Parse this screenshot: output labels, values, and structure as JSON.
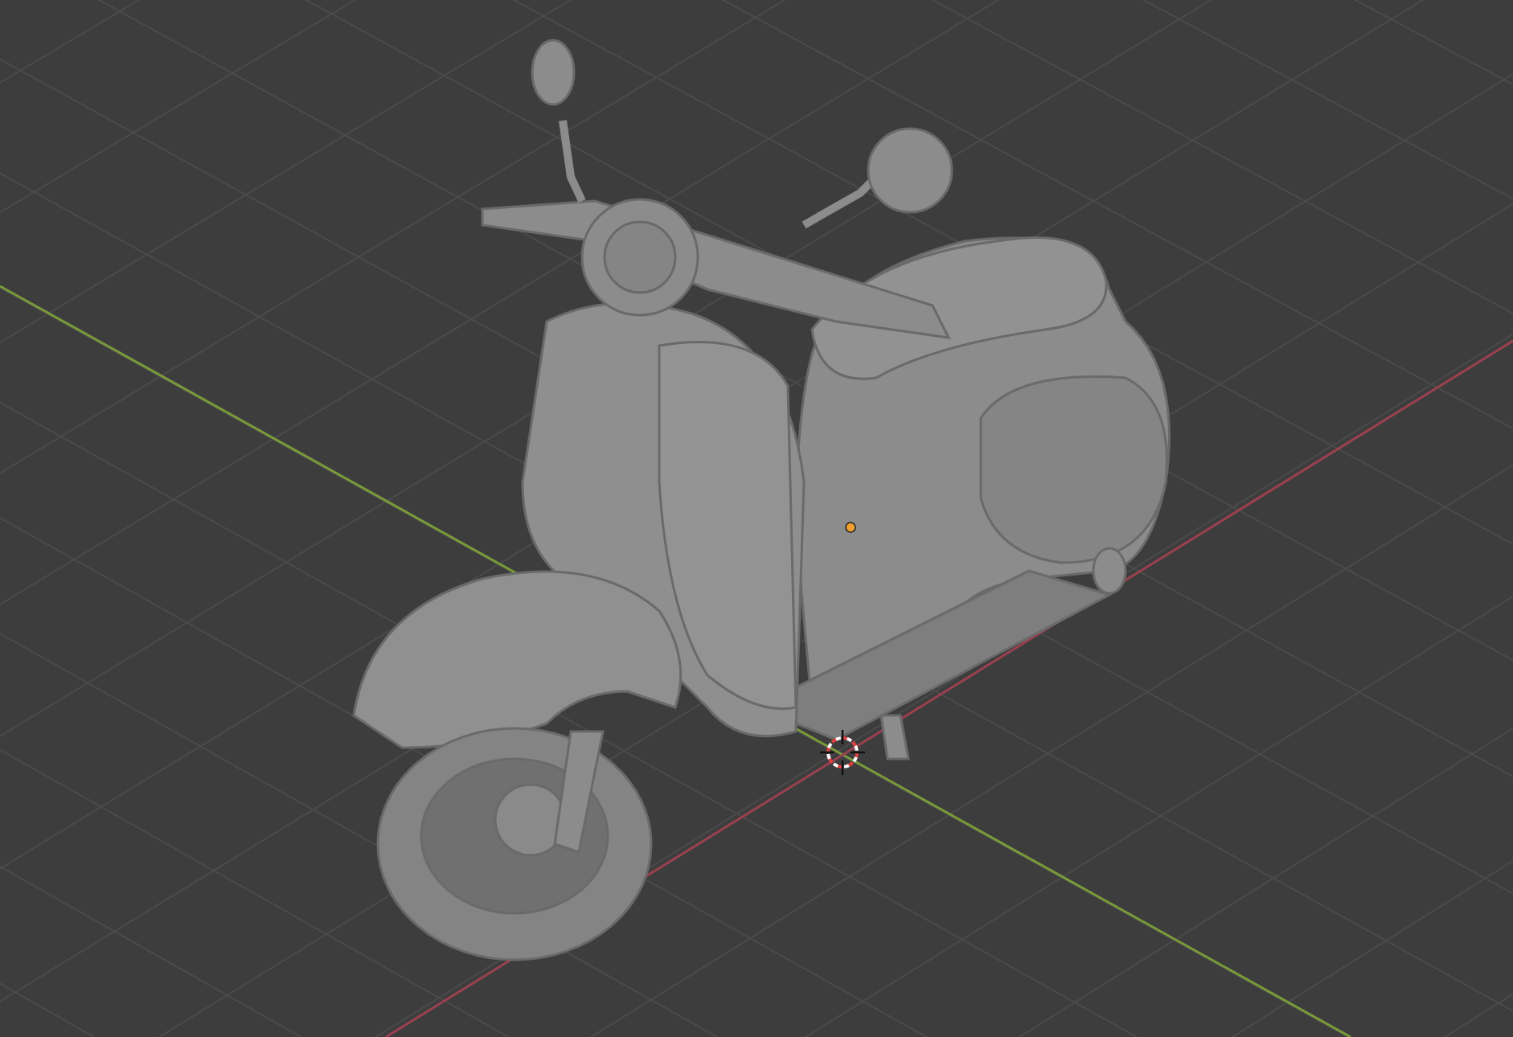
{
  "viewport": {
    "show_grid": true,
    "show_axes": true,
    "show_3d_cursor": true,
    "show_origin": true
  }
}
